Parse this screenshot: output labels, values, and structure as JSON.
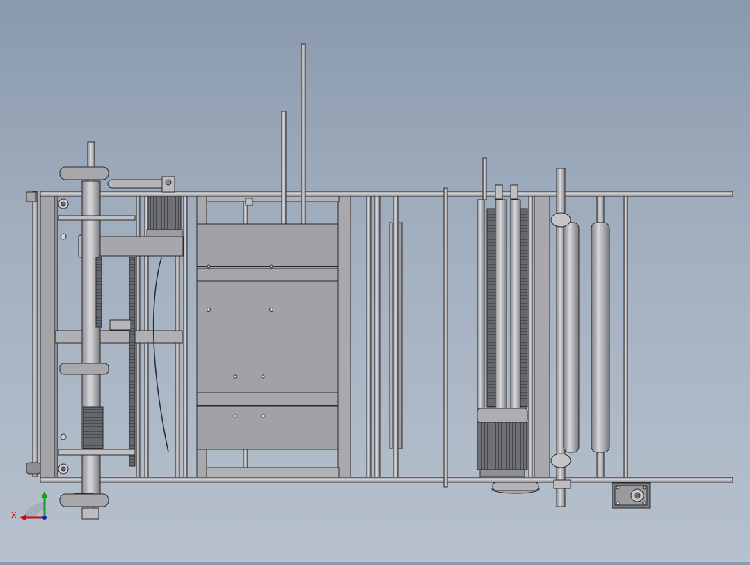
{
  "viewport": {
    "background_top": "#8a99ad",
    "background_bottom": "#b7c1cd"
  },
  "model": {
    "line_color": "#2a2a2e",
    "part_fill": "#a7a7ab",
    "panel_fill": "#9fa0a4",
    "motor_fill": "#6f7075"
  },
  "triad": {
    "x_label": "X",
    "x_color": "#c0101a",
    "y_color": "#10a020",
    "z_color": "#1020c0"
  }
}
